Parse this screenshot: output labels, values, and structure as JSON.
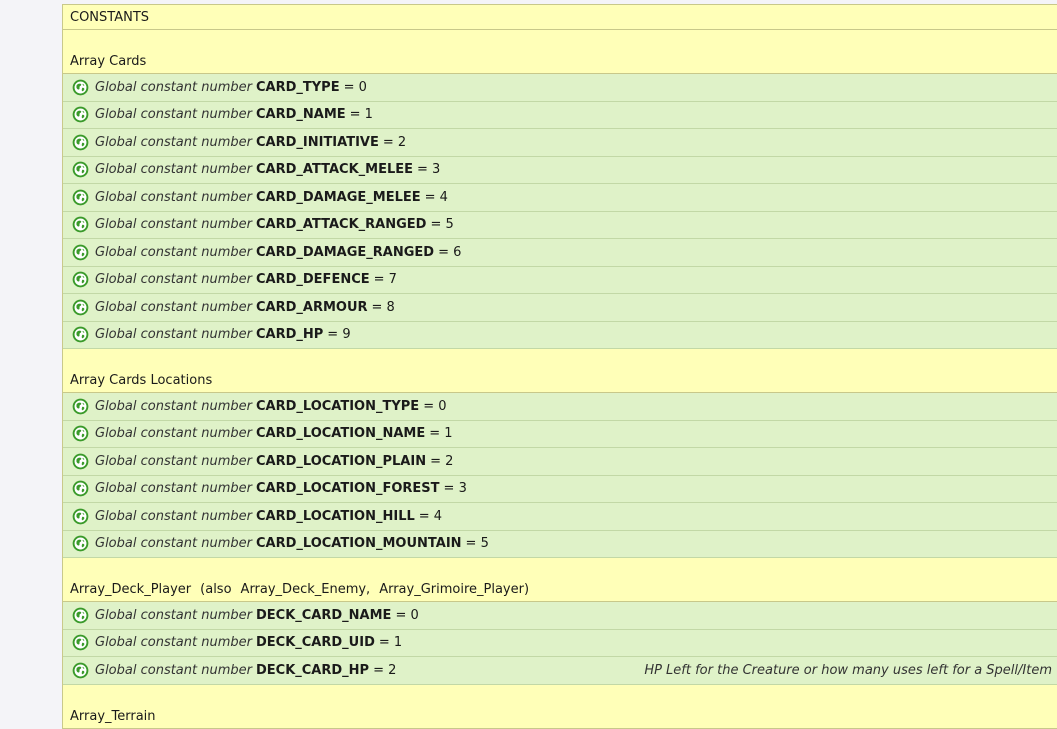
{
  "title": "CONSTANTS",
  "kind_label": "Global constant number",
  "sections": [
    {
      "label": "Array Cards",
      "items": [
        {
          "name": "CARD_TYPE",
          "value": "= 0"
        },
        {
          "name": "CARD_NAME",
          "value": "= 1"
        },
        {
          "name": "CARD_INITIATIVE",
          "value": "= 2"
        },
        {
          "name": "CARD_ATTACK_MELEE",
          "value": "= 3"
        },
        {
          "name": "CARD_DAMAGE_MELEE",
          "value": "= 4"
        },
        {
          "name": "CARD_ATTACK_RANGED",
          "value": "= 5"
        },
        {
          "name": "CARD_DAMAGE_RANGED",
          "value": "= 6"
        },
        {
          "name": "CARD_DEFENCE",
          "value": "= 7"
        },
        {
          "name": "CARD_ARMOUR",
          "value": "= 8"
        },
        {
          "name": "CARD_HP",
          "value": "= 9"
        }
      ]
    },
    {
      "label": "Array Cards Locations",
      "items": [
        {
          "name": "CARD_LOCATION_TYPE",
          "value": "= 0"
        },
        {
          "name": "CARD_LOCATION_NAME",
          "value": "= 1"
        },
        {
          "name": "CARD_LOCATION_PLAIN",
          "value": "= 2"
        },
        {
          "name": "CARD_LOCATION_FOREST",
          "value": "= 3"
        },
        {
          "name": "CARD_LOCATION_HILL",
          "value": "= 4"
        },
        {
          "name": "CARD_LOCATION_MOUNTAIN",
          "value": "= 5"
        }
      ]
    },
    {
      "label_parts": [
        "Array_Deck_Player",
        "(also",
        "Array_Deck_Enemy,",
        "Array_Grimoire_Player)"
      ],
      "items": [
        {
          "name": "DECK_CARD_NAME",
          "value": "= 0"
        },
        {
          "name": "DECK_CARD_UID",
          "value": "= 1"
        },
        {
          "name": "DECK_CARD_HP",
          "value": "= 2",
          "note": "HP Left for the Creature or how many uses left for a Spell/Item"
        }
      ]
    },
    {
      "label": "Array_Terrain",
      "items": []
    }
  ],
  "icon": "globe-icon",
  "colors": {
    "header_bg": "#ffffb8",
    "row_bg": "#dff2c8",
    "globe": "#3a9a2a"
  }
}
